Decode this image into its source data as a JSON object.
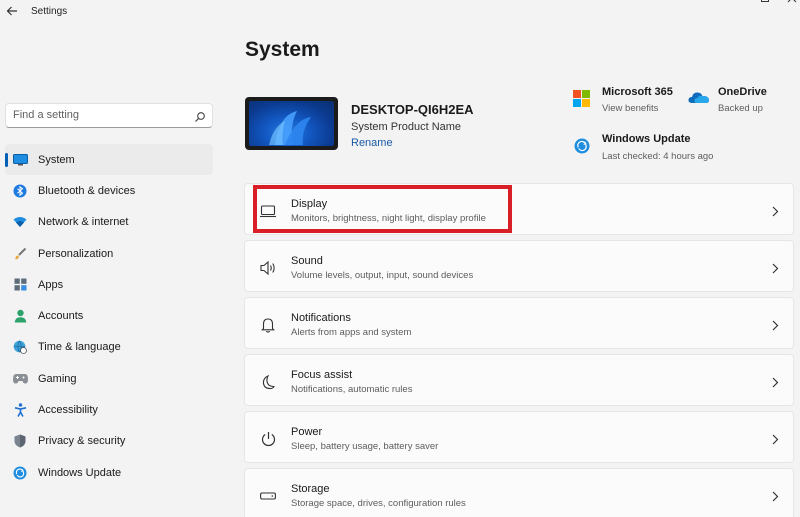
{
  "app": {
    "title": "Settings"
  },
  "search": {
    "placeholder": "Find a setting"
  },
  "sidebar": {
    "items": [
      {
        "label": "System",
        "icon": "monitor-icon",
        "active": true
      },
      {
        "label": "Bluetooth & devices",
        "icon": "bluetooth-icon"
      },
      {
        "label": "Network & internet",
        "icon": "wifi-icon"
      },
      {
        "label": "Personalization",
        "icon": "brush-icon"
      },
      {
        "label": "Apps",
        "icon": "apps-icon"
      },
      {
        "label": "Accounts",
        "icon": "person-icon"
      },
      {
        "label": "Time & language",
        "icon": "globe-clock-icon"
      },
      {
        "label": "Gaming",
        "icon": "gamepad-icon"
      },
      {
        "label": "Accessibility",
        "icon": "accessibility-icon"
      },
      {
        "label": "Privacy & security",
        "icon": "shield-icon"
      },
      {
        "label": "Windows Update",
        "icon": "update-icon"
      }
    ]
  },
  "main": {
    "title": "System",
    "device": {
      "name": "DESKTOP-QI6H2EA",
      "model": "System Product Name",
      "rename_label": "Rename"
    },
    "quick": {
      "m365": {
        "title": "Microsoft 365",
        "sub": "View benefits"
      },
      "onedrive": {
        "title": "OneDrive",
        "sub": "Backed up"
      },
      "update": {
        "title": "Windows Update",
        "sub": "Last checked: 4 hours ago"
      }
    },
    "cards": [
      {
        "title": "Display",
        "sub": "Monitors, brightness, night light, display profile",
        "icon": "display-icon"
      },
      {
        "title": "Sound",
        "sub": "Volume levels, output, input, sound devices",
        "icon": "speaker-icon"
      },
      {
        "title": "Notifications",
        "sub": "Alerts from apps and system",
        "icon": "bell-icon"
      },
      {
        "title": "Focus assist",
        "sub": "Notifications, automatic rules",
        "icon": "moon-icon"
      },
      {
        "title": "Power",
        "sub": "Sleep, battery usage, battery saver",
        "icon": "power-icon"
      },
      {
        "title": "Storage",
        "sub": "Storage space, drives, configuration rules",
        "icon": "storage-icon"
      }
    ]
  },
  "colors": {
    "accent": "#005fb8",
    "highlight": "#d81e27"
  }
}
